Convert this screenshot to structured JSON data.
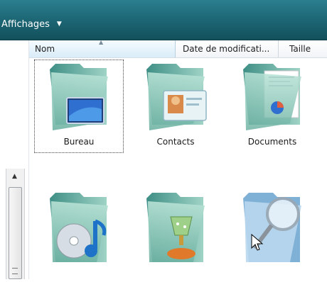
{
  "toolbar": {
    "views_label": "Affichages"
  },
  "columns": {
    "name": "Nom",
    "date": "Date de modificati...",
    "size": "Taille"
  },
  "items": [
    {
      "label": "Bureau",
      "icon": "folder-desktop-icon"
    },
    {
      "label": "Contacts",
      "icon": "folder-contacts-icon"
    },
    {
      "label": "Documents",
      "icon": "folder-documents-icon"
    },
    {
      "label": "",
      "icon": "folder-music-icon"
    },
    {
      "label": "",
      "icon": "folder-games-icon"
    },
    {
      "label": "",
      "icon": "folder-searches-icon"
    }
  ],
  "colors": {
    "toolbar": "#1f6b7a",
    "folder": "#7fbfb0",
    "selection": "#404040"
  }
}
